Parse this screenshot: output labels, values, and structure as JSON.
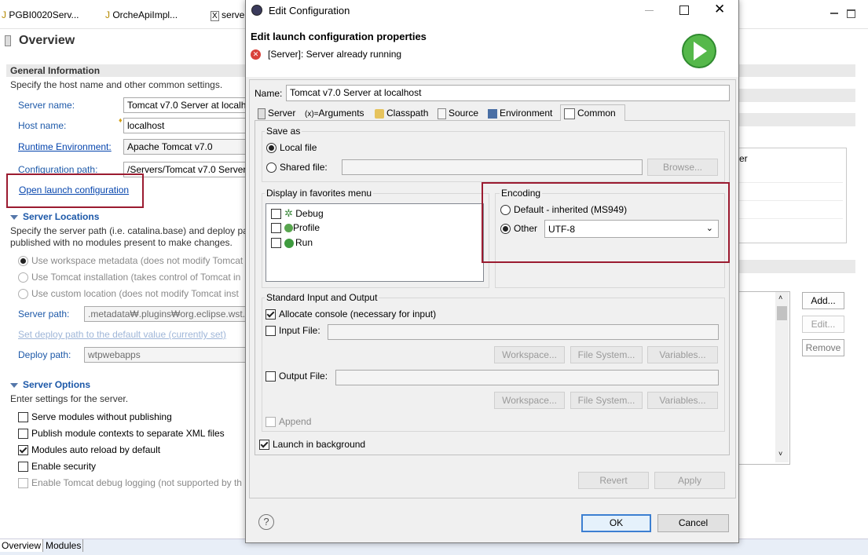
{
  "editor_tabs": [
    {
      "label": "PGBI0020Serv..."
    },
    {
      "label": "OrcheApiImpl..."
    },
    {
      "label": "serve"
    }
  ],
  "overview": {
    "title": "Overview",
    "general": {
      "title": "General Information",
      "desc": "Specify the host name and other common settings.",
      "server_name_label": "Server name:",
      "server_name": "Tomcat v7.0 Server at localh",
      "host_name_label": "Host name:",
      "host_name": "localhost",
      "runtime_label": "Runtime Environment:",
      "runtime": "Apache Tomcat v7.0",
      "config_path_label": "Configuration path:",
      "config_path": "/Servers/Tomcat v7.0 Server",
      "open_launch": "Open launch configuration"
    },
    "locations": {
      "title": "Server Locations",
      "desc1": "Specify the server path (i.e. catalina.base) and deploy pa",
      "desc2": "published with no modules present to make changes.",
      "opt1": "Use workspace metadata (does not modify Tomcat",
      "opt2": "Use Tomcat installation (takes control of Tomcat in",
      "opt3": "Use custom location (does not modify Tomcat inst",
      "server_path_label": "Server path:",
      "server_path": ".metadata₩.plugins₩org.eclipse.wst.se",
      "set_deploy": "Set deploy path to the default value (currently set)",
      "deploy_path_label": "Deploy path:",
      "deploy_path": "wtpwebapps"
    },
    "options": {
      "title": "Server Options",
      "desc": "Enter settings for the server.",
      "items": [
        {
          "label": "Serve modules without publishing"
        },
        {
          "label": "Publish module contexts to separate XML files"
        },
        {
          "label": "Modules auto reload by default"
        },
        {
          "label": "Enable security"
        },
        {
          "label": "Enable Tomcat debug logging (not supported by th"
        }
      ]
    },
    "right_panel": {
      "er_text": "er",
      "add": "Add...",
      "edit": "Edit...",
      "remove": "Remove"
    },
    "bottom_tabs": [
      {
        "label": "Overview"
      },
      {
        "label": "Modules"
      }
    ]
  },
  "dialog": {
    "title": "Edit Configuration",
    "heading": "Edit launch configuration properties",
    "error": "[Server]: Server already running",
    "name_label": "Name:",
    "name_value": "Tomcat v7.0 Server at localhost",
    "tabs": [
      {
        "label": "Server"
      },
      {
        "label": "Arguments"
      },
      {
        "label": "Classpath"
      },
      {
        "label": "Source"
      },
      {
        "label": "Environment"
      },
      {
        "label": "Common"
      }
    ],
    "save_as": {
      "title": "Save as",
      "local": "Local file",
      "shared": "Shared file:",
      "browse": "Browse..."
    },
    "favorites": {
      "title": "Display in favorites menu",
      "items": [
        {
          "label": "Debug"
        },
        {
          "label": "Profile"
        },
        {
          "label": "Run"
        }
      ]
    },
    "encoding": {
      "title": "Encoding",
      "default": "Default - inherited (MS949)",
      "other": "Other",
      "value": "UTF-8"
    },
    "std_io": {
      "title": "Standard Input and Output",
      "allocate": "Allocate console (necessary for input)",
      "input_file": "Input File:",
      "output_file": "Output File:",
      "workspace": "Workspace...",
      "file_system": "File System...",
      "variables": "Variables...",
      "append": "Append"
    },
    "launch_bg": "Launch in background",
    "revert": "Revert",
    "apply": "Apply",
    "ok": "OK",
    "cancel": "Cancel",
    "help": "?"
  },
  "colors": {
    "highlight_box": "#9b1b30",
    "link": "#0645ad",
    "section": "#1c58a8",
    "ok_border": "#3c7fd1"
  }
}
